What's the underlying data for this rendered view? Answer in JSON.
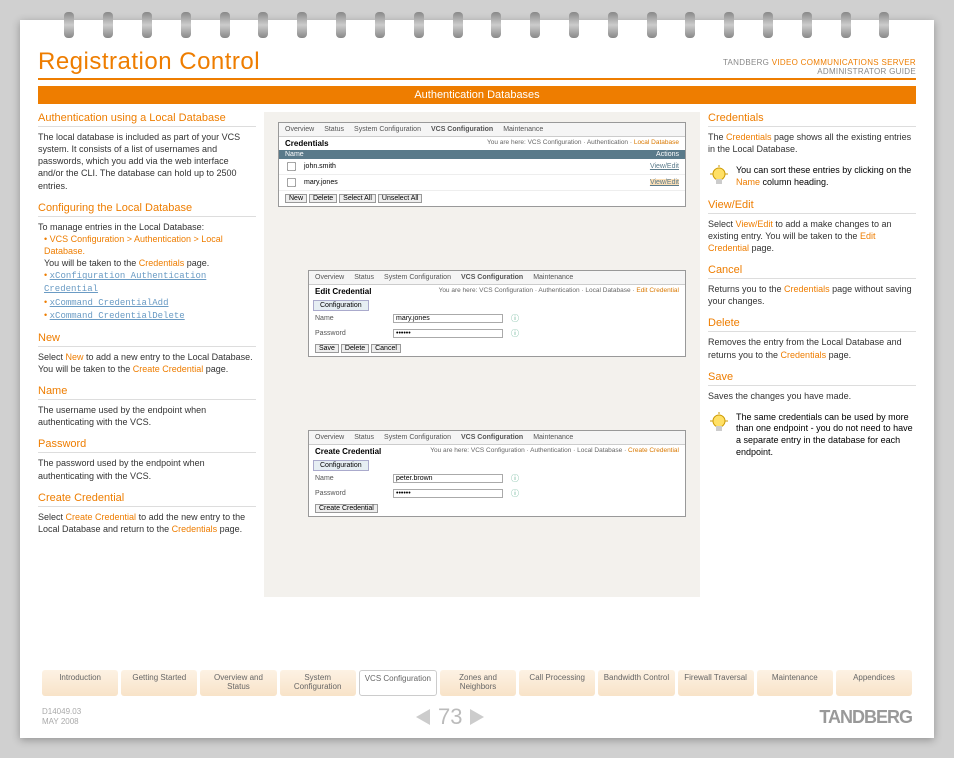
{
  "header": {
    "title": "Registration Control",
    "brand": "TANDBERG",
    "product": "VIDEO COMMUNICATIONS SERVER",
    "guide": "ADMINISTRATOR GUIDE",
    "banner": "Authentication Databases"
  },
  "left": {
    "s1": {
      "h": "Authentication using a Local Database",
      "b": "The local database is included as part of your VCS system. It consists of a list of usernames and passwords, which you add via the web interface and/or the CLI. The database can hold up to 2500 entries."
    },
    "s2": {
      "h": "Configuring the Local Database",
      "intro": "To manage entries in the Local Database:",
      "li1a": "VCS Configuration > Authentication > Local Database.",
      "li1b": "You will be taken to the ",
      "li1c": "Credentials",
      "li1d": " page.",
      "li2": "xConfiguration Authentication Credential",
      "li3": "xCommand CredentialAdd",
      "li4": "xCommand CredentialDelete"
    },
    "s3": {
      "h": "New",
      "a": "Select ",
      "b": "New",
      "c": " to add a new entry to the Local Database. You will be taken to the ",
      "d": "Create Credential",
      "e": " page."
    },
    "s4": {
      "h": "Name",
      "b": "The username used by the endpoint when authenticating with the VCS."
    },
    "s5": {
      "h": "Password",
      "b": "The password used by the endpoint when authenticating with the VCS."
    },
    "s6": {
      "h": "Create Credential",
      "a": "Select ",
      "b": "Create Credential",
      "c": " to add the new entry to the Local Database and return to the ",
      "d": "Credentials",
      "e": " page."
    }
  },
  "mid": {
    "tabs": {
      "overview": "Overview",
      "status": "Status",
      "sysconf": "System Configuration",
      "vcsconf": "VCS Configuration",
      "maint": "Maintenance"
    },
    "shot1": {
      "title": "Credentials",
      "crumb_pre": "You are here: VCS Configuration · Authentication · ",
      "crumb_cur": "Local Database",
      "col_name": "Name",
      "col_actions": "Actions",
      "row1": "john.smith",
      "row2": "mary.jones",
      "viewedit": "View/Edit",
      "btn_new": "New",
      "btn_delete": "Delete",
      "btn_selectall": "Select All",
      "btn_unselectall": "Unselect All"
    },
    "shot2": {
      "title": "Edit Credential",
      "crumb_pre": "You are here: VCS Configuration · Authentication · Local Database · ",
      "crumb_cur": "Edit Credential",
      "tab": "Configuration",
      "lbl_name": "Name",
      "val_name": "mary.jones",
      "lbl_pass": "Password",
      "val_pass": "••••••",
      "btn_save": "Save",
      "btn_delete": "Delete",
      "btn_cancel": "Cancel"
    },
    "shot3": {
      "title": "Create Credential",
      "crumb_pre": "You are here: VCS Configuration · Authentication · Local Database · ",
      "crumb_cur": "Create Credential",
      "tab": "Configuration",
      "lbl_name": "Name",
      "val_name": "peter.brown",
      "lbl_pass": "Password",
      "val_pass": "••••••",
      "btn": "Create Credential"
    }
  },
  "right": {
    "s1": {
      "h": "Credentials",
      "a": "The ",
      "b": "Credentials",
      "c": " page shows all the existing entries in the Local Database."
    },
    "tip1": {
      "a": "You can sort these entries by clicking on the ",
      "b": "Name",
      "c": " column heading."
    },
    "s2": {
      "h": "View/Edit",
      "a": "Select ",
      "b": "View/Edit",
      "c": " to add a make changes to an existing entry. You will be taken to the ",
      "d": "Edit Credential",
      "e": " page."
    },
    "s3": {
      "h": "Cancel",
      "a": "Returns you to the ",
      "b": "Credentials",
      "c": " page without saving your changes."
    },
    "s4": {
      "h": "Delete",
      "a": "Removes the entry from the Local Database and returns you to the ",
      "b": "Credentials",
      "c": " page."
    },
    "s5": {
      "h": "Save",
      "b": "Saves the changes you have made."
    },
    "tip2": "The same credentials can be used by more than one endpoint - you do not need to have a separate entry in the database for each endpoint."
  },
  "navtabs": [
    "Introduction",
    "Getting Started",
    "Overview and Status",
    "System Configuration",
    "VCS Configuration",
    "Zones and Neighbors",
    "Call Processing",
    "Bandwidth Control",
    "Firewall Traversal",
    "Maintenance",
    "Appendices"
  ],
  "footer": {
    "doc": "D14049.03",
    "date": "MAY 2008",
    "page": "73",
    "brand": "TANDBERG"
  }
}
